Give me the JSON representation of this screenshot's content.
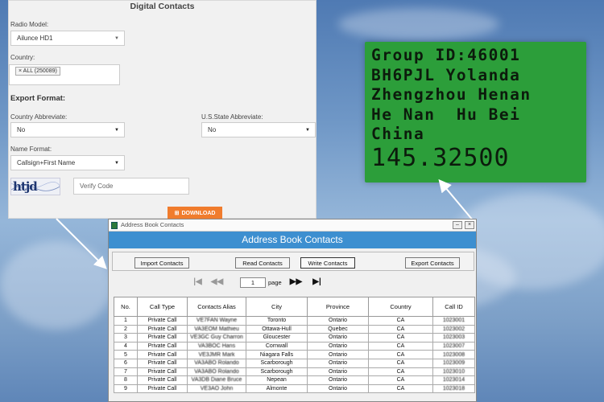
{
  "form": {
    "title": "Digital Contacts",
    "radio_model_label": "Radio Model:",
    "radio_model_value": "Ailunce HD1",
    "country_label": "Country:",
    "country_tag": "× ALL (250089)",
    "export_format_label": "Export Format:",
    "country_abbrev_label": "Country Abbreviate:",
    "country_abbrev_value": "No",
    "us_state_abbrev_label": "U.S.State Abbreviate:",
    "us_state_abbrev_value": "No",
    "name_format_label": "Name Format:",
    "name_format_value": "Callsign+First Name",
    "captcha_text": "htjd",
    "verify_placeholder": "Verify Code",
    "download_label": "DOWNLOAD"
  },
  "radio_display": {
    "lines": [
      "Group ID:46001",
      "BH6PJL Yolanda",
      "Zhengzhou Henan",
      "He Nan  Hu Bei",
      "China"
    ],
    "frequency": "145.32500"
  },
  "window": {
    "title": "Address Book Contacts",
    "banner": "Address Book Contacts",
    "buttons": {
      "import": "Import Contacts",
      "read": "Read Contacts",
      "write": "Write Contacts",
      "export": "Export Contacts"
    },
    "pager": {
      "page_value": "1",
      "page_label": "page"
    },
    "columns": [
      "No.",
      "Call Type",
      "Contacts Alias",
      "City",
      "Province",
      "Country",
      "Call ID"
    ],
    "rows": [
      {
        "no": "1",
        "type": "Private Call",
        "alias": "VE7FAN Wayne",
        "city": "Toronto",
        "province": "Ontario",
        "country": "CA",
        "id": "1023001"
      },
      {
        "no": "2",
        "type": "Private Call",
        "alias": "VA3EOM Mathieu",
        "city": "Ottawa-Hull",
        "province": "Quebec",
        "country": "CA",
        "id": "1023002"
      },
      {
        "no": "3",
        "type": "Private Call",
        "alias": "VE3GC Guy Charron",
        "city": "Gloucester",
        "province": "Ontario",
        "country": "CA",
        "id": "1023003"
      },
      {
        "no": "4",
        "type": "Private Call",
        "alias": "VA3BOC Hans",
        "city": "Cornwall",
        "province": "Ontario",
        "country": "CA",
        "id": "1023007"
      },
      {
        "no": "5",
        "type": "Private Call",
        "alias": "VE3JMR Mark",
        "city": "Niagara Falls",
        "province": "Ontario",
        "country": "CA",
        "id": "1023008"
      },
      {
        "no": "6",
        "type": "Private Call",
        "alias": "VA3ABO Rolando",
        "city": "Scarborough",
        "province": "Ontario",
        "country": "CA",
        "id": "1023009"
      },
      {
        "no": "7",
        "type": "Private Call",
        "alias": "VA3ABO Rolando",
        "city": "Scarborough",
        "province": "Ontario",
        "country": "CA",
        "id": "1023010"
      },
      {
        "no": "8",
        "type": "Private Call",
        "alias": "VA3DB Diane Bruce",
        "city": "Nepean",
        "province": "Ontario",
        "country": "CA",
        "id": "1023014"
      },
      {
        "no": "9",
        "type": "Private Call",
        "alias": "VE3AO John",
        "city": "Almonte",
        "province": "Ontario",
        "country": "CA",
        "id": "1023018"
      }
    ]
  },
  "colors": {
    "banner": "#3d8fd0",
    "download_button": "#f07c2d",
    "lcd_background": "#2c9e3a"
  }
}
